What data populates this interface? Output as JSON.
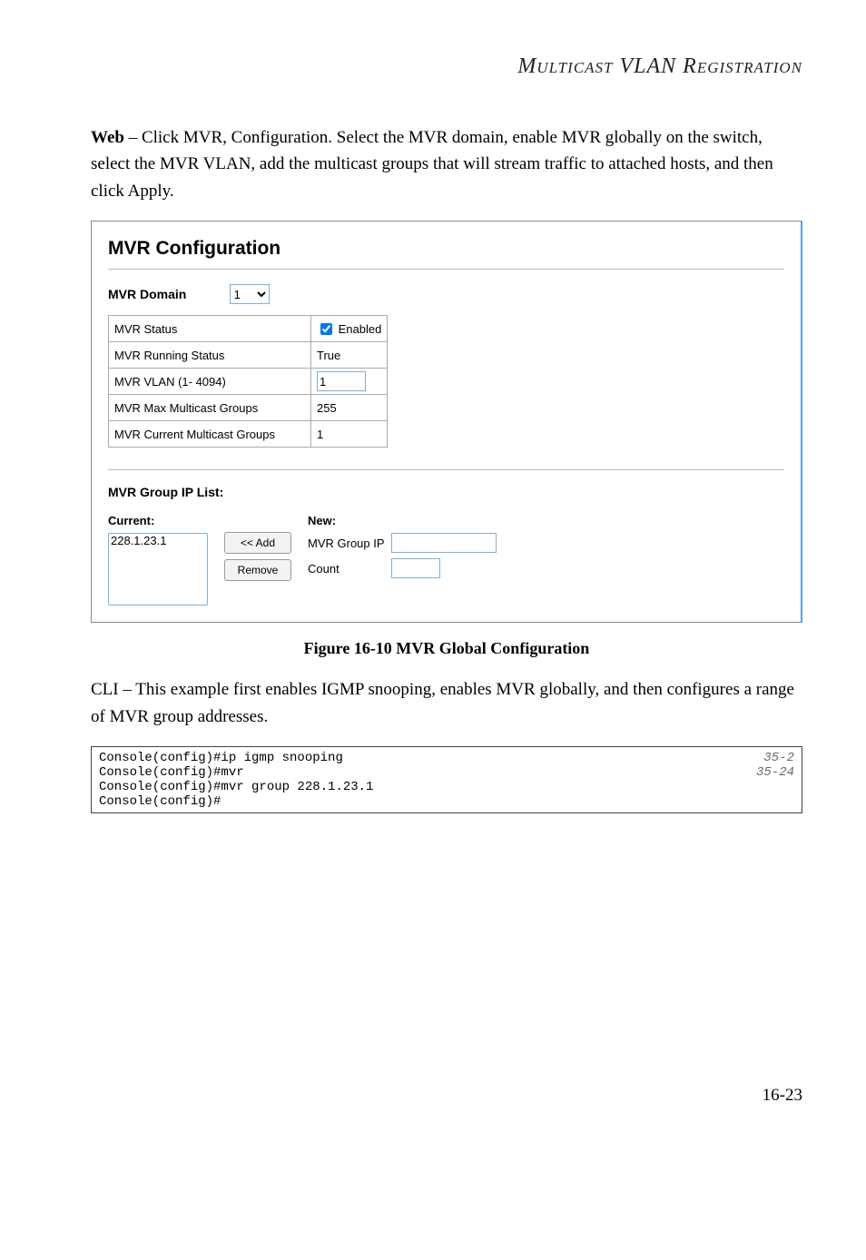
{
  "header": {
    "section_title": "Multicast VLAN Registration"
  },
  "intro": {
    "lead_bold": "Web",
    "lead_text": " – Click MVR, Configuration. Select the MVR domain, enable MVR globally on the switch, select the MVR VLAN, add the multicast groups that will stream traffic to attached hosts, and then click Apply."
  },
  "mvr_panel": {
    "title": "MVR Configuration",
    "domain_label": "MVR Domain",
    "domain_value": "1",
    "rows": {
      "status_label": "MVR Status",
      "status_checkbox_checked": "true",
      "enabled_text": "Enabled",
      "running_label": "MVR Running Status",
      "running_value": "True",
      "vlan_label": "MVR VLAN (1- 4094)",
      "vlan_value": "1",
      "max_label": "MVR Max Multicast Groups",
      "max_value": "255",
      "current_label": "MVR Current Multicast Groups",
      "current_value": "1"
    },
    "group_list": {
      "section": "MVR Group IP List:",
      "current_heading": "Current:",
      "new_heading": "New:",
      "current_items": [
        "228.1.23.1"
      ],
      "add_btn": "<< Add",
      "remove_btn": "Remove",
      "group_ip_label": "MVR Group IP",
      "group_ip_value": "",
      "count_label": "Count",
      "count_value": ""
    }
  },
  "figure_caption": "Figure 16-10  MVR Global Configuration",
  "cli_intro": "CLI – This example first enables IGMP snooping, enables MVR globally, and then configures a range of MVR group addresses.",
  "cli": {
    "lines": "Console(config)#ip igmp snooping\nConsole(config)#mvr\nConsole(config)#mvr group 228.1.23.1\nConsole(config)#",
    "refs": "35-2\n35-24\n\n"
  },
  "page_number": "16-23"
}
